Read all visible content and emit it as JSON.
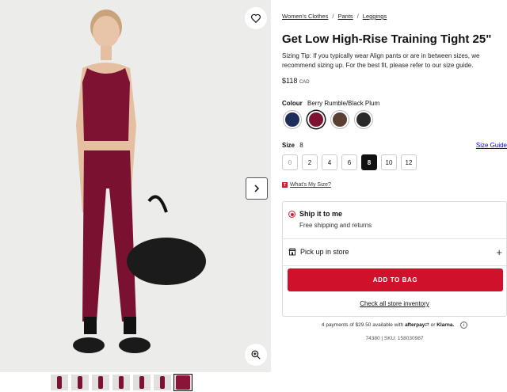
{
  "gallery": {
    "thumbnail_count": 7,
    "selected_thumbnail": 7
  },
  "breadcrumb": {
    "items": [
      "Women's Clothes",
      "Pants",
      "Leggings"
    ],
    "separator": "/"
  },
  "product": {
    "title": "Get Low High-Rise Training Tight 25\"",
    "sizing_tip": "Sizing Tip: If you typically wear Align pants or are in between sizes, we recommend sizing up. For the best fit, please refer to our size guide.",
    "price": "$118",
    "currency": "CAD"
  },
  "colour": {
    "label": "Colour",
    "selected_name": "Berry Rumble/Black Plum",
    "swatches": [
      {
        "name": "navy",
        "color": "#1d2d5c",
        "selected": false
      },
      {
        "name": "berry",
        "color": "#7e1232",
        "selected": true
      },
      {
        "name": "brown",
        "color": "#5a3f33",
        "selected": false
      },
      {
        "name": "black",
        "color": "#2a2a2a",
        "selected": false
      }
    ]
  },
  "size": {
    "label": "Size",
    "selected": "8",
    "guide_label": "Size Guide",
    "options": [
      "0",
      "2",
      "4",
      "6",
      "8",
      "10",
      "12"
    ],
    "whats_my_size": "What's My Size?",
    "tag_letter": "T"
  },
  "fulfilment": {
    "ship_label": "Ship it to me",
    "ship_sub": "Free shipping and returns",
    "pickup_label": "Pick up in store",
    "plus": "+",
    "add_to_bag": "ADD TO BAG",
    "inventory_link": "Check all store inventory"
  },
  "payments": {
    "afterpay_text": "4 payments of $29.50 available with",
    "afterpay_brand": "afterpay",
    "or": "or",
    "klarna": "Klarna.",
    "info": "i"
  },
  "sku": "74380 | SKU: 158030987",
  "colors": {
    "accent_red": "#d0112b",
    "product_berry": "#7e1232"
  }
}
